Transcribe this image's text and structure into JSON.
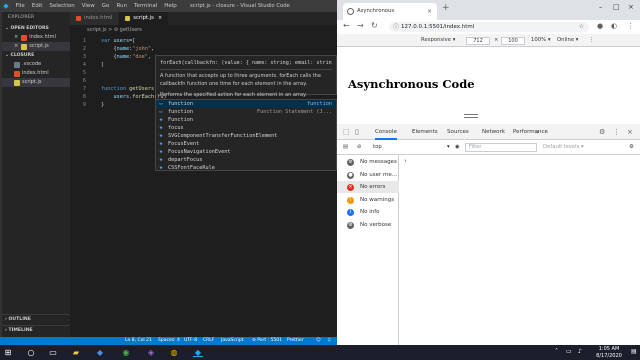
{
  "vscode": {
    "menu": [
      "File",
      "Edit",
      "Selection",
      "View",
      "Go",
      "Run",
      "Terminal",
      "Help"
    ],
    "window_title": "script.js - closure - Visual Studio Code",
    "explorer_header": "EXPLORER",
    "open_editors_header": "OPEN EDITORS",
    "open_editors": [
      {
        "name": "index.html",
        "type": "html"
      },
      {
        "name": "script.js",
        "type": "js",
        "active": true
      }
    ],
    "folder_header": "CLOSURE",
    "folder_items": [
      {
        "name": ".vscode",
        "type": "dir"
      },
      {
        "name": "index.html",
        "type": "html"
      },
      {
        "name": "script.js",
        "type": "js",
        "active": true
      }
    ],
    "outline_label": "OUTLINE",
    "timeline_label": "TIMELINE",
    "tabs": [
      {
        "label": "index.html",
        "type": "html"
      },
      {
        "label": "script.js",
        "type": "js",
        "active": true
      }
    ],
    "breadcrumb": "script.js > ⊘ getUsers",
    "lines": [
      {
        "n": "1",
        "tokens": [
          [
            "k",
            "var "
          ],
          [
            "v",
            "users"
          ],
          [
            "p",
            "=["
          ]
        ]
      },
      {
        "n": "2",
        "tokens": [
          [
            "p",
            "    {"
          ],
          [
            "v",
            "name"
          ],
          [
            "p",
            ":"
          ],
          [
            "s",
            "\"john\""
          ],
          [
            "p",
            ","
          ]
        ]
      },
      {
        "n": "3",
        "tokens": [
          [
            "p",
            "    {"
          ],
          [
            "v",
            "name"
          ],
          [
            "p",
            ":"
          ],
          [
            "s",
            "\"doe\""
          ],
          [
            "p",
            ","
          ]
        ]
      },
      {
        "n": "4",
        "tokens": [
          [
            "p",
            "]"
          ]
        ]
      },
      {
        "n": "5",
        "tokens": []
      },
      {
        "n": "6",
        "tokens": []
      },
      {
        "n": "7",
        "tokens": [
          [
            "k",
            "function "
          ],
          [
            "f",
            "getUsers"
          ],
          [
            "p",
            "("
          ]
        ]
      },
      {
        "n": "8",
        "tokens": [
          [
            "p",
            "    "
          ],
          [
            "v",
            "users"
          ],
          [
            "p",
            "."
          ],
          [
            "f",
            "forEach"
          ],
          [
            "p",
            "(fu)"
          ]
        ]
      },
      {
        "n": "9",
        "tokens": [
          [
            "p",
            "}"
          ]
        ]
      }
    ],
    "hover": {
      "signature": "forEach(callbackfn: (value: { name: string; email: string; }, index: number, array: { name: string; email: string; }[]) => void, thisArg?: any): void",
      "description": "A function that accepts up to three arguments. forEach calls the callbackfn function one time for each element in the array.",
      "description2": "Performs the specified action for each element in an array."
    },
    "suggestions": [
      {
        "icon": "keyword-icon",
        "label": "function",
        "detail": "function",
        "selected": true
      },
      {
        "icon": "snippet-icon",
        "label": "function",
        "detail": "Function Statement (J..."
      },
      {
        "icon": "class-icon",
        "label": "Function",
        "detail": ""
      },
      {
        "icon": "method-icon",
        "label": "focus",
        "detail": ""
      },
      {
        "icon": "class-icon",
        "label": "SVGComponentTransferFunctionElement",
        "detail": ""
      },
      {
        "icon": "class-icon",
        "label": "FocusEvent",
        "detail": ""
      },
      {
        "icon": "class-icon",
        "label": "FocusNavigationEvent",
        "detail": ""
      },
      {
        "icon": "variable-icon",
        "label": "departFocus",
        "detail": ""
      },
      {
        "icon": "class-icon",
        "label": "CSSFontFaceRule",
        "detail": ""
      }
    ],
    "status": {
      "position": "Ln 8, Col 21",
      "spaces": "Spaces: 4",
      "encoding": "UTF-8",
      "eol": "CRLF",
      "language": "JavaScript",
      "port": "Port : 5501",
      "prettier": "Prettier"
    }
  },
  "browser": {
    "tab_title": "Asynchronous",
    "url": "127.0.0.1:5501/index.html",
    "device": "Responsive",
    "width": "712",
    "height": "100",
    "zoom": "100%",
    "network": "Online",
    "page_heading": "Asynchronous Code",
    "devtools_tabs": [
      "Console",
      "Elements",
      "Sources",
      "Network",
      "Performance"
    ],
    "active_devtools_tab": "Console",
    "context": "top",
    "filter_placeholder": "Filter",
    "levels": "Default levels",
    "sidebar": [
      {
        "label": "No messages",
        "icon": "list-icon",
        "color": "#5f6368"
      },
      {
        "label": "No user me...",
        "icon": "user-icon",
        "color": "#5f6368"
      },
      {
        "label": "No errors",
        "icon": "error-icon",
        "color": "#d93025",
        "selected": true
      },
      {
        "label": "No warnings",
        "icon": "warning-icon",
        "color": "#f29900"
      },
      {
        "label": "No info",
        "icon": "info-icon",
        "color": "#1a73e8"
      },
      {
        "label": "No verbose",
        "icon": "verbose-icon",
        "color": "#5f6368"
      }
    ]
  },
  "taskbar": {
    "time": "1:05 AM",
    "date": "8/17/2020"
  }
}
